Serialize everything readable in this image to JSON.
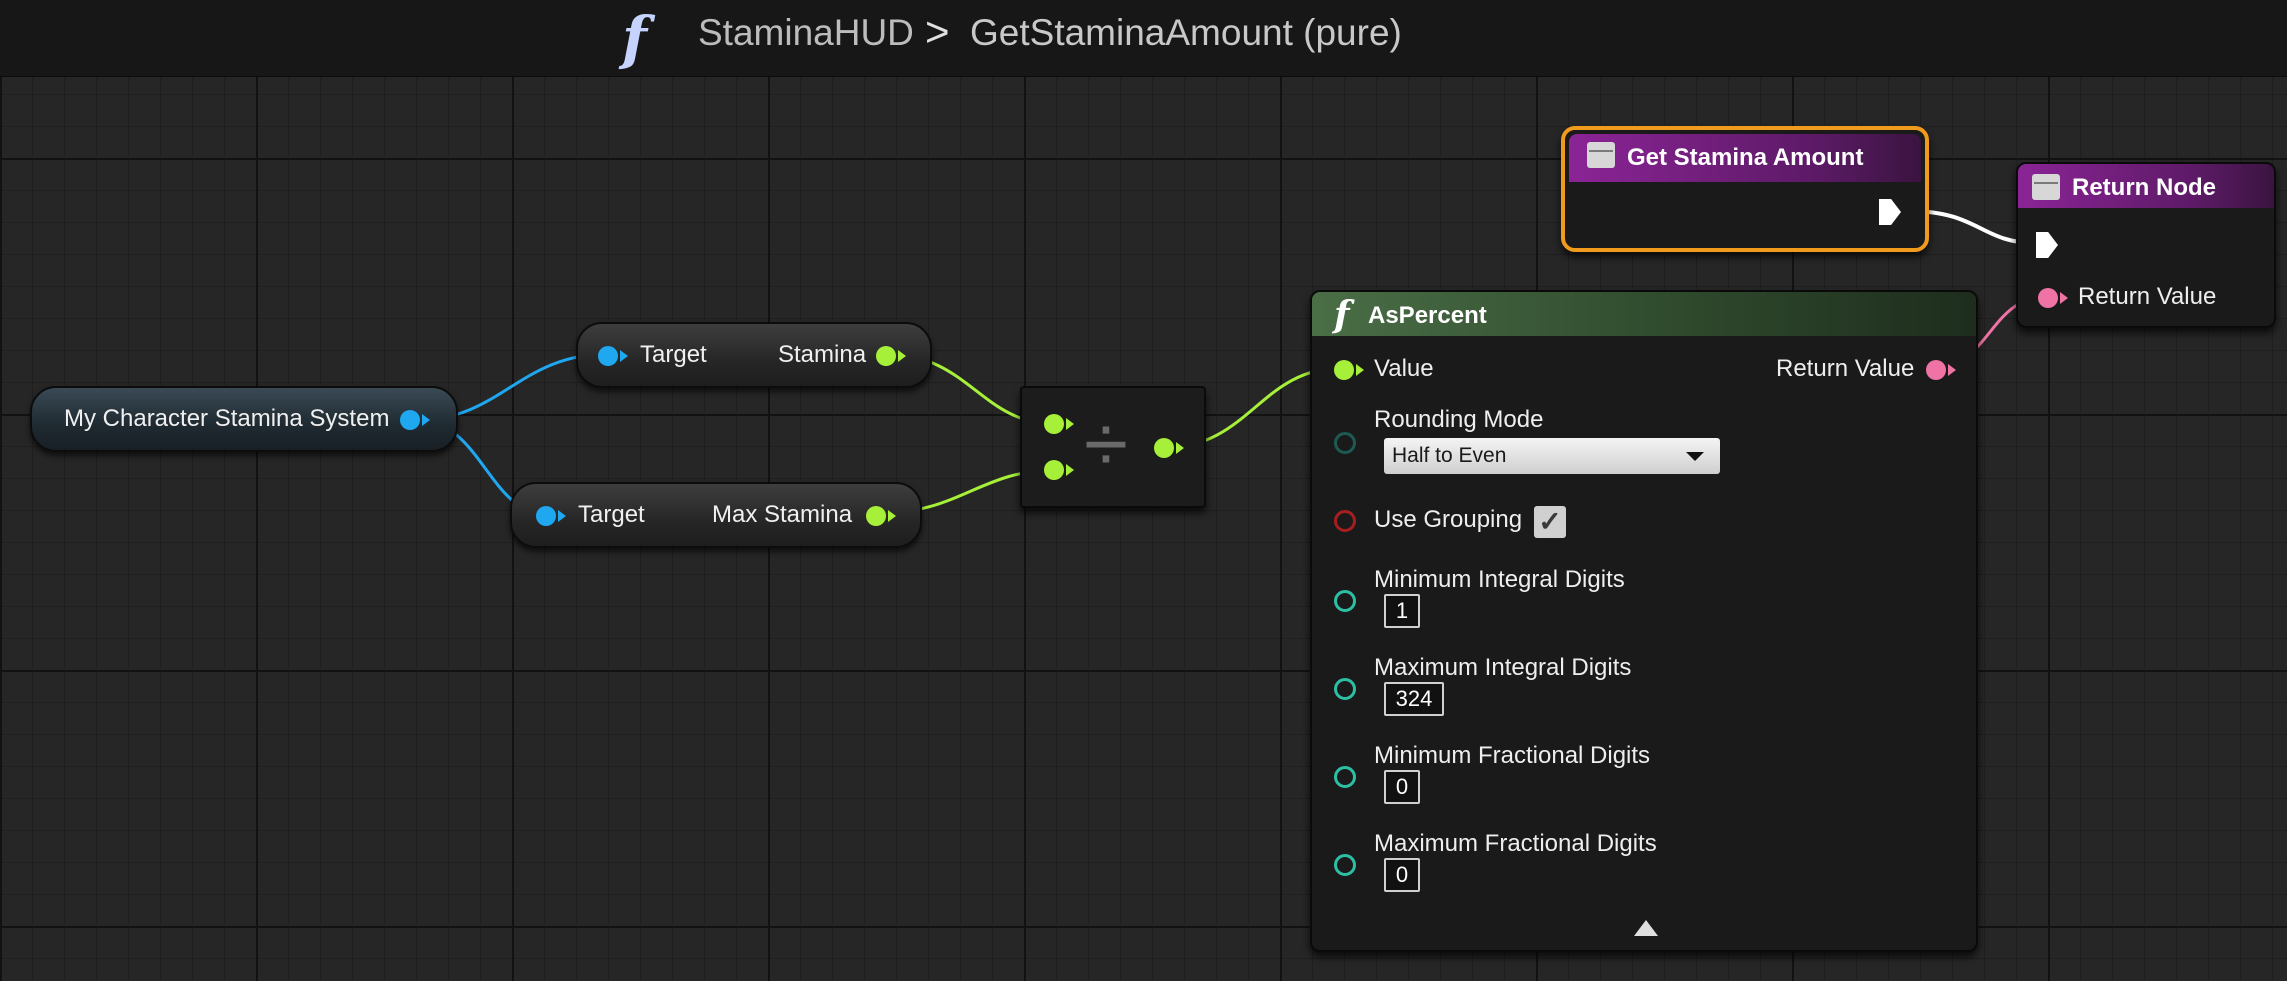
{
  "breadcrumb": {
    "function_icon": "f",
    "parent": "StaminaHUD",
    "separator": ">",
    "current": "GetStaminaAmount (pure)"
  },
  "nodes": {
    "stamina_system": {
      "label": "My Character Stamina System",
      "out_pin_color": "#1fa7f0"
    },
    "get_stamina": {
      "target_label": "Target",
      "output_label": "Stamina"
    },
    "get_max_stamina": {
      "target_label": "Target",
      "output_label": "Max Stamina"
    },
    "divide": {
      "operator": "÷"
    },
    "entry": {
      "title": "Get Stamina Amount",
      "header_color": "#7b1c86",
      "selected_border": "#f09a1e"
    },
    "return_node": {
      "title": "Return Node",
      "return_label": "Return Value",
      "header_color": "#7b1c86"
    },
    "as_percent": {
      "title": "AsPercent",
      "icon": "f",
      "header_color": "#3e5c3a",
      "value_label": "Value",
      "return_label": "Return Value",
      "rounding_mode_label": "Rounding Mode",
      "rounding_mode_value": "Half to Even",
      "use_grouping_label": "Use Grouping",
      "use_grouping_checked": true,
      "min_integral_label": "Minimum Integral Digits",
      "min_integral_value": "1",
      "max_integral_label": "Maximum Integral Digits",
      "max_integral_value": "324",
      "min_fractional_label": "Minimum Fractional Digits",
      "min_fractional_value": "0",
      "max_fractional_label": "Maximum Fractional Digits",
      "max_fractional_value": "0"
    }
  },
  "colors": {
    "object_pin": "#1fa7f0",
    "float_pin": "#a6f03a",
    "text_pin": "#ef74a5",
    "int_pin": "#2cbfa4",
    "bool_pin": "#a61e1e",
    "exec_pin": "#ffffff"
  }
}
